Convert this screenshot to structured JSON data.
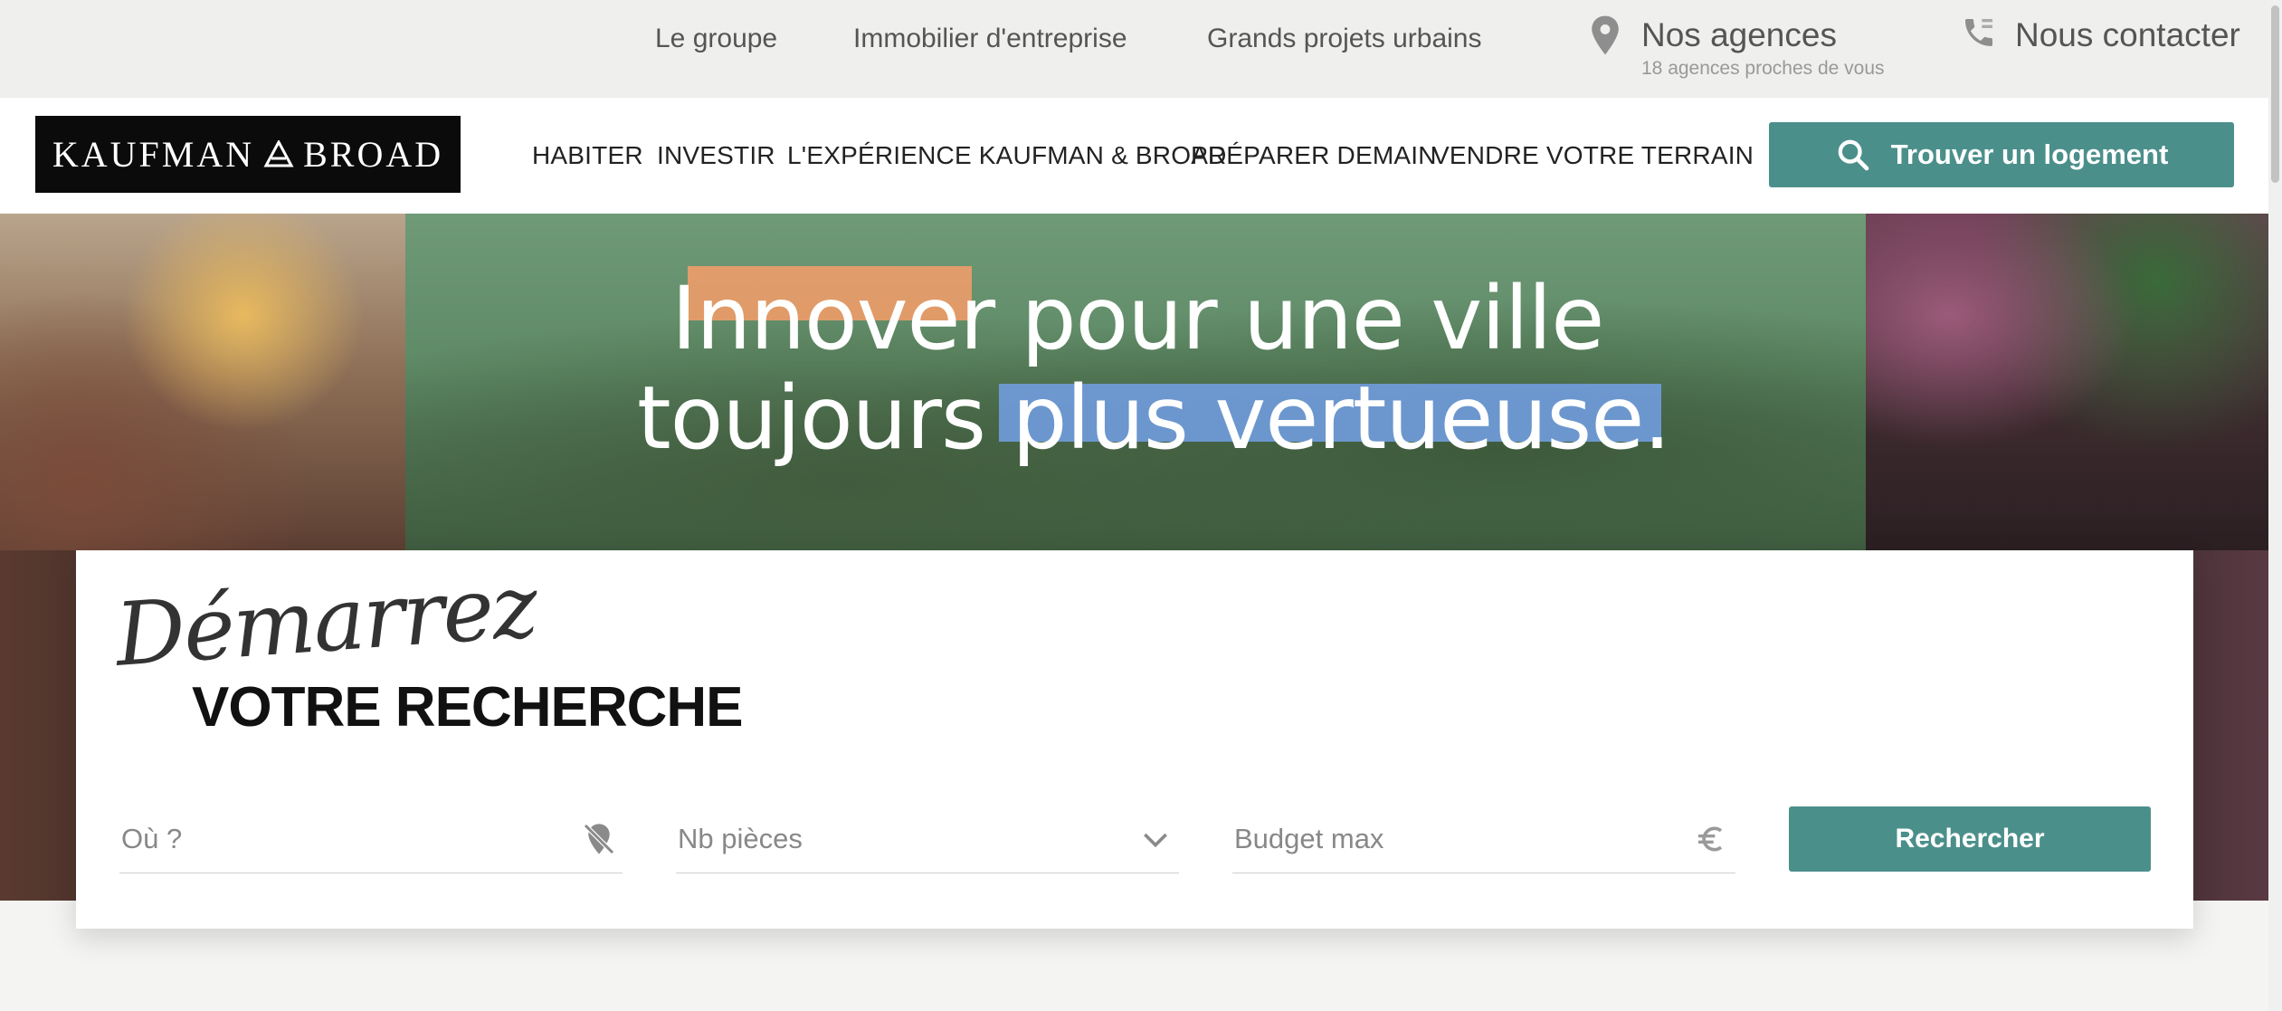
{
  "topbar": {
    "links": [
      "Le groupe",
      "Immobilier d'entreprise",
      "Grands projets urbains"
    ],
    "agences": {
      "label": "Nos agences",
      "sub": "18 agences proches de vous",
      "icon": "map-pin-icon"
    },
    "contact": {
      "label": "Nous contacter",
      "icon": "phone-icon"
    }
  },
  "header": {
    "logo": {
      "left": "KAUFMAN",
      "right": "BROAD"
    },
    "nav": [
      "HABITER",
      "INVESTIR",
      "L'EXPÉRIENCE KAUFMAN & BROAD",
      "PRÉPARER DEMAIN",
      "VENDRE VOTRE TERRAIN"
    ],
    "cta": {
      "label": "Trouver un logement",
      "icon": "search-icon"
    }
  },
  "hero": {
    "line1": "Innover pour une ville",
    "line2": "toujours plus vertueuse.",
    "highlight_colors": {
      "orange": "#e79c69",
      "blue": "#6f9ad6"
    }
  },
  "search": {
    "script_title": "Démarrez",
    "title": "VOTRE RECHERCHE",
    "fields": [
      {
        "placeholder": "Où ?",
        "icon": "location-off-icon"
      },
      {
        "placeholder": "Nb pièces",
        "icon": "chevron-down-icon"
      },
      {
        "placeholder": "Budget max",
        "icon": "euro-icon"
      }
    ],
    "button": "Rechercher"
  },
  "colors": {
    "accent": "#4b8f8b",
    "topbar_bg": "#efefed",
    "logo_bg": "#0b0b0b"
  }
}
